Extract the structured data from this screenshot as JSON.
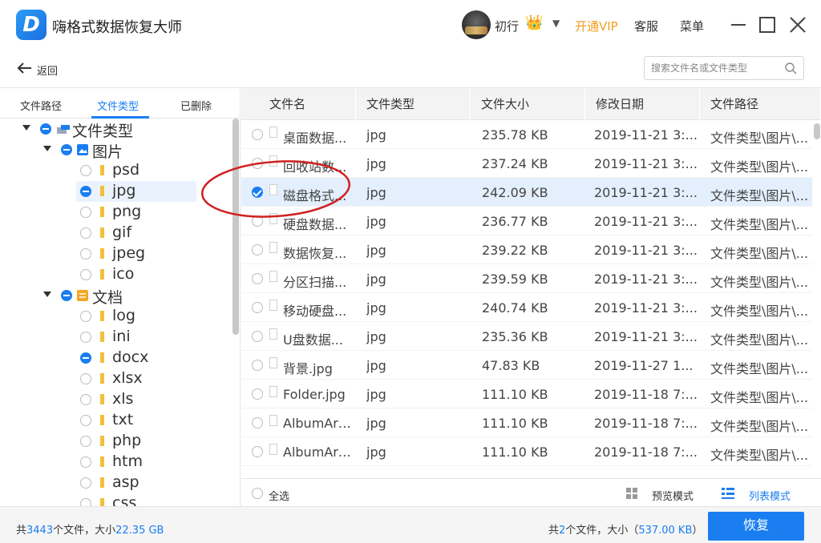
{
  "app": {
    "title": "嗨格式数据恢复大师",
    "logo_letter": "D"
  },
  "header": {
    "username": "初行",
    "crown": "👑",
    "dropdown": "▼",
    "vip_label": "开通VIP",
    "service_label": "客服",
    "menu_label": "菜单"
  },
  "nav": {
    "back_label": "返回",
    "search_placeholder": "搜索文件名或文件类型"
  },
  "left": {
    "tabs": [
      "文件路径",
      "文件类型",
      "已删除"
    ],
    "active_tab": "文件类型",
    "tree": {
      "root": "文件类型",
      "groups": [
        {
          "label": "图片",
          "items": [
            "psd",
            "jpg",
            "png",
            "gif",
            "jpeg",
            "ico"
          ]
        },
        {
          "label": "文档",
          "items": [
            "log",
            "ini",
            "docx",
            "xlsx",
            "xls",
            "txt",
            "php",
            "htm",
            "asp",
            "css"
          ]
        }
      ],
      "selected": "jpg"
    }
  },
  "table": {
    "columns": [
      "文件名",
      "文件类型",
      "文件大小",
      "修改日期",
      "文件路径"
    ],
    "rows": [
      {
        "name": "桌面数据...",
        "type": "jpg",
        "size": "235.78 KB",
        "date": "2019-11-21 3:...",
        "path": "文件类型\\图片\\...",
        "checked": false
      },
      {
        "name": "回收站数...",
        "type": "jpg",
        "size": "237.24 KB",
        "date": "2019-11-21 3:...",
        "path": "文件类型\\图片\\...",
        "checked": false
      },
      {
        "name": "磁盘格式...",
        "type": "jpg",
        "size": "242.09 KB",
        "date": "2019-11-21 3:...",
        "path": "文件类型\\图片\\...",
        "checked": true
      },
      {
        "name": "硬盘数据...",
        "type": "jpg",
        "size": "236.77 KB",
        "date": "2019-11-21 3:...",
        "path": "文件类型\\图片\\...",
        "checked": false
      },
      {
        "name": "数据恢复...",
        "type": "jpg",
        "size": "239.22 KB",
        "date": "2019-11-21 3:...",
        "path": "文件类型\\图片\\...",
        "checked": false
      },
      {
        "name": "分区扫描...",
        "type": "jpg",
        "size": "239.59 KB",
        "date": "2019-11-21 3:...",
        "path": "文件类型\\图片\\...",
        "checked": false
      },
      {
        "name": "移动硬盘...",
        "type": "jpg",
        "size": "240.74 KB",
        "date": "2019-11-21 3:...",
        "path": "文件类型\\图片\\...",
        "checked": false
      },
      {
        "name": "U盘数据...",
        "type": "jpg",
        "size": "235.36 KB",
        "date": "2019-11-21 3:...",
        "path": "文件类型\\图片\\...",
        "checked": false
      },
      {
        "name": "背景.jpg",
        "type": "jpg",
        "size": "47.83 KB",
        "date": "2019-11-27 1...",
        "path": "文件类型\\图片\\...",
        "checked": false
      },
      {
        "name": "Folder.jpg",
        "type": "jpg",
        "size": "111.10 KB",
        "date": "2019-11-18 7:...",
        "path": "文件类型\\图片\\...",
        "checked": false
      },
      {
        "name": "AlbumArt...",
        "type": "jpg",
        "size": "111.10 KB",
        "date": "2019-11-18 7:...",
        "path": "文件类型\\图片\\...",
        "checked": false
      },
      {
        "name": "AlbumArt...",
        "type": "jpg",
        "size": "111.10 KB",
        "date": "2019-11-18 7:...",
        "path": "文件类型\\图片\\...",
        "checked": false
      }
    ],
    "select_all_label": "全选",
    "preview_mode_label": "预览模式",
    "list_mode_label": "列表模式"
  },
  "footer": {
    "total_prefix": "共",
    "total_count": "3443",
    "total_mid": "个文件，大小",
    "total_size": "22.35 GB",
    "sel_prefix": "共",
    "sel_count": "2",
    "sel_mid": "个文件，大小（",
    "sel_size": "537.00 KB",
    "sel_suffix": "）",
    "recover_label": "恢复"
  },
  "colors": {
    "accent": "#1a7ef0",
    "vip": "#f0a020",
    "annotation": "#d02020"
  }
}
